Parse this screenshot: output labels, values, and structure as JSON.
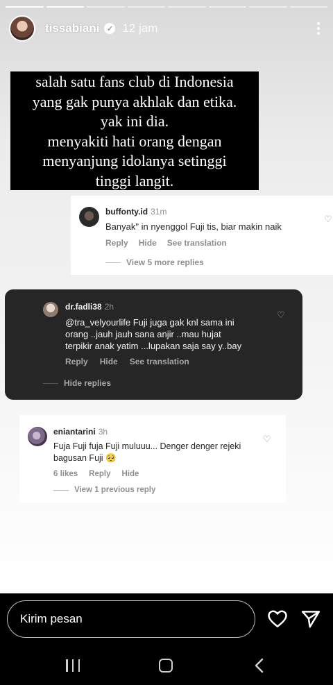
{
  "story": {
    "username": "tissabiani",
    "time": "12 jam",
    "progress_segments": 8,
    "progress_done": 2,
    "caption_lines": [
      "salah satu fans club di Indonesia",
      "yang gak punya akhlak dan etika.",
      "yak ini dia.",
      "menyakiti hati orang dengan",
      "menyanjung idolanya setinggi",
      "tinggi langit."
    ]
  },
  "comment1": {
    "user": "buffonty.id",
    "time": "31m",
    "text": "Banyak\" in nyenggol Fuji tis, biar makin naik",
    "reply": "Reply",
    "hide": "Hide",
    "translate": "See translation",
    "more_replies": "View 5 more replies"
  },
  "comment2": {
    "user": "dr.fadli38",
    "time": "2h",
    "text_lines": [
      "@tra_velyourlife Fuji juga gak knl sama ini",
      "orang ..jauh jauh sana anjir ..mau hujat",
      "terpikir anak yatim ...lupakan saja say y..bay"
    ],
    "reply": "Reply",
    "hide": "Hide",
    "translate": "See translation",
    "hide_replies": "Hide replies"
  },
  "comment3": {
    "user": "eniantarini",
    "time": "3h",
    "text_lines": [
      "Fuja Fuji fuja Fuji muluuu... Denger denger rejeki",
      "bagusan Fuji 🥺"
    ],
    "likes": "6 likes",
    "reply": "Reply",
    "hide": "Hide",
    "previous_reply": "View 1 previous reply"
  },
  "composer": {
    "placeholder": "Kirim pesan"
  },
  "icons": {
    "verified": "verified-badge-icon",
    "more": "more-vertical-icon",
    "like": "heart-icon",
    "send": "send-icon"
  }
}
